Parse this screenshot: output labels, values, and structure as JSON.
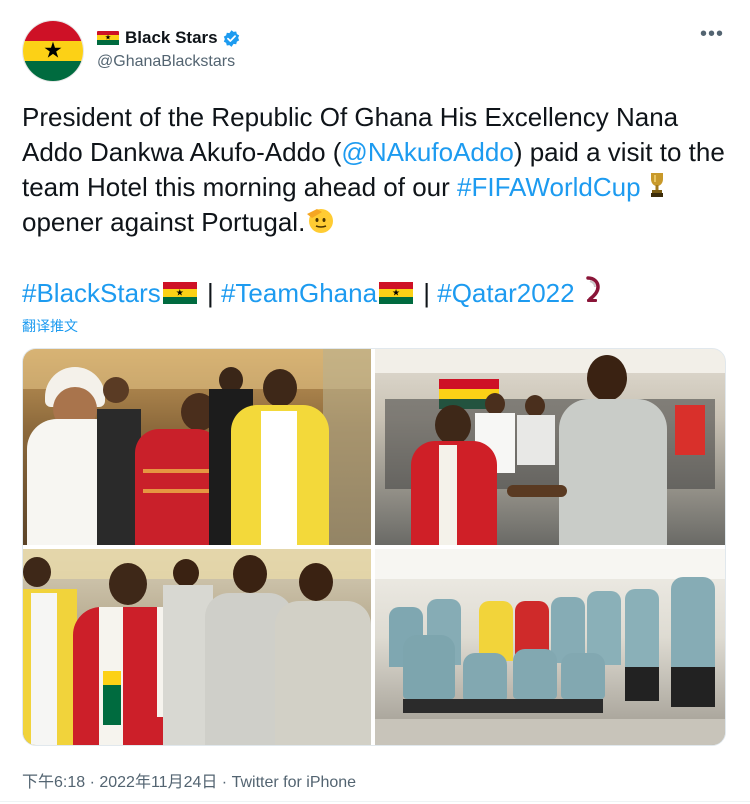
{
  "header": {
    "display_name": "Black Stars",
    "handle": "@GhanaBlackstars",
    "more_label": "•••",
    "avatar_icon": "ghana-flag-avatar",
    "verified_icon": "verified-badge-icon"
  },
  "tweet": {
    "text_part1": "President of the Republic Of Ghana His Excellency Nana Addo Dankwa Akufo-Addo (",
    "mention": "@NAkufoAddo",
    "text_part2": ") paid a visit to the team Hotel this morning ahead of our ",
    "hashtag_worldcup": "#FIFAWorldCup",
    "text_part3": " opener against Portugal.",
    "hashtag_blackstars": "#BlackStars",
    "separator1": " | ",
    "hashtag_teamghana": "#TeamGhana",
    "separator2": " | ",
    "hashtag_qatar": "#Qatar2022",
    "translate_label": "翻译推文",
    "emojis": [
      "trophy",
      "saluting-face",
      "ghana-flag",
      "qatar-2022-logo"
    ]
  },
  "media": {
    "photos": [
      "president-with-officials",
      "president-shaking-hands-with-player",
      "president-with-players",
      "team-group-photo"
    ]
  },
  "footer": {
    "timestamp": "下午6:18 · 2022年11月24日 · Twitter for iPhone"
  },
  "colors": {
    "link": "#1d9bf0",
    "secondary_text": "#536471",
    "ghana_red": "#ce1126",
    "ghana_gold": "#fcd116",
    "ghana_green": "#006b3f"
  }
}
